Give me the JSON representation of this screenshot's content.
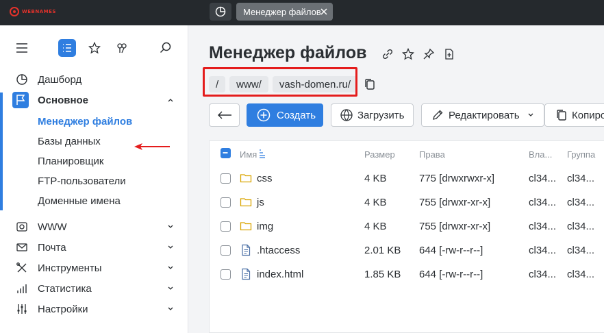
{
  "topbar": {
    "logo_text": "WEBNAMES",
    "tab_label": "Менеджер файлов"
  },
  "sidebar": {
    "items": [
      {
        "label": "Дашборд",
        "icon": "pie-chart-icon"
      },
      {
        "label": "Основное",
        "icon": "flag-icon"
      },
      {
        "label": "WWW",
        "icon": "www-icon"
      },
      {
        "label": "Почта",
        "icon": "mail-icon"
      },
      {
        "label": "Инструменты",
        "icon": "tools-icon"
      },
      {
        "label": "Статистика",
        "icon": "stats-icon"
      },
      {
        "label": "Настройки",
        "icon": "sliders-icon"
      }
    ],
    "sub_items": [
      {
        "label": "Менеджер файлов"
      },
      {
        "label": "Базы данных"
      },
      {
        "label": "Планировщик"
      },
      {
        "label": "FTP-пользователи"
      },
      {
        "label": "Доменные имена"
      }
    ]
  },
  "main": {
    "title": "Менеджер файлов",
    "breadcrumbs": [
      "/",
      "www/",
      "vash-domen.ru/"
    ],
    "toolbar": {
      "create": "Создать",
      "upload": "Загрузить",
      "edit": "Редактировать",
      "copy": "Копиро"
    },
    "table": {
      "headers": {
        "name": "Имя",
        "size": "Размер",
        "rights": "Права",
        "owner": "Вла...",
        "group": "Группа"
      },
      "rows": [
        {
          "name": "css",
          "type": "folder",
          "size": "4 KB",
          "rights": "775 [drwxrwxr-x]",
          "owner": "cl34...",
          "group": "cl34..."
        },
        {
          "name": "js",
          "type": "folder",
          "size": "4 KB",
          "rights": "755 [drwxr-xr-x]",
          "owner": "cl34...",
          "group": "cl34..."
        },
        {
          "name": "img",
          "type": "folder",
          "size": "4 KB",
          "rights": "755 [drwxr-xr-x]",
          "owner": "cl34...",
          "group": "cl34..."
        },
        {
          "name": ".htaccess",
          "type": "file",
          "size": "2.01 KB",
          "rights": "644 [-rw-r--r--]",
          "owner": "cl34...",
          "group": "cl34..."
        },
        {
          "name": "index.html",
          "type": "file",
          "size": "1.85 KB",
          "rights": "644 [-rw-r--r--]",
          "owner": "cl34...",
          "group": "cl34..."
        }
      ]
    }
  },
  "colors": {
    "accent": "#2f7ee0",
    "highlight": "#e41c1c",
    "topbar": "#25292d"
  }
}
